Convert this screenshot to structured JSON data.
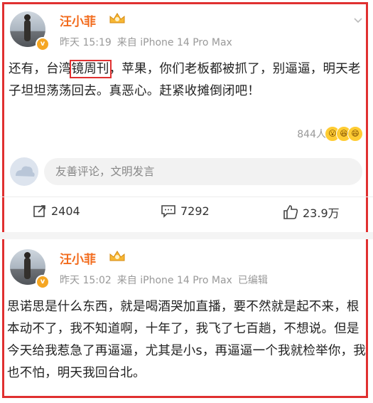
{
  "posts": [
    {
      "author": "汪小菲",
      "time": "昨天 15:19",
      "source": "来自 iPhone 14 Pro Max",
      "edited": "",
      "text_before": "还有，台湾",
      "text_highlight": "镜周刊",
      "text_after": "，苹果，你们老板都被抓了，别逼逼，明天老子坦坦荡荡回去。真恶心。赶紧收摊倒闭吧！",
      "likes_count": "844人",
      "reactions": [
        "😮",
        "😆",
        "😄"
      ],
      "comment_placeholder": "友善评论，文明发言",
      "actions": {
        "repost": "2404",
        "comment": "7292",
        "like": "23.9万"
      }
    },
    {
      "author": "汪小菲",
      "time": "昨天 15:02",
      "source": "来自 iPhone 14 Pro Max",
      "edited": "已编辑",
      "text": "思诺思是什么东西，就是喝酒哭加直播，要不然就是起不来，根本动不了，我不知道啊，十年了，我飞了七百趟，不想说。但是今天给我惹急了再逼逼，尤其是小s，再逼逼一个我就检举你，我也不怕，明天我回台北。"
    }
  ],
  "colors": {
    "name": "#f26b1d",
    "highlight_border": "#e03030",
    "meta": "#999999"
  }
}
